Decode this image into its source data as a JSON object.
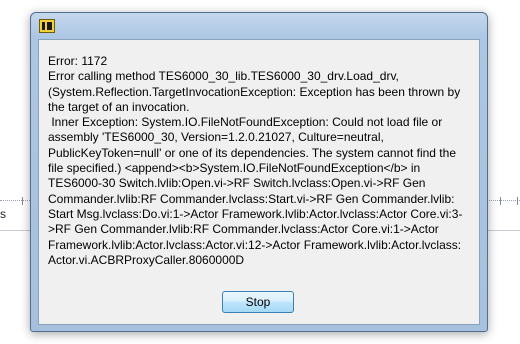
{
  "background": {
    "partial_label": "s"
  },
  "dialog": {
    "title": "",
    "icon": "labview-icon",
    "message": "Error: 1172\nError calling method TES6000_30_lib.TES6000_30_drv.Load_drv,\n(System.Reflection.TargetInvocationException: Exception has been thrown by\nthe target of an invocation.\n Inner Exception: System.IO.FileNotFoundException: Could not load file or\nassembly 'TES6000_30, Version=1.2.0.21027, Culture=neutral,\nPublicKeyToken=null' or one of its dependencies. The system cannot find the\nfile specified.) <append><b>System.IO.FileNotFoundException</b> in\nTES6000-30 Switch.lvlib:Open.vi->RF Switch.lvclass:Open.vi->RF Gen\nCommander.lvlib:RF Commander.lvclass:Start.vi->RF Gen Commander.lvlib:\nStart Msg.lvclass:Do.vi:1->Actor Framework.lvlib:Actor.lvclass:Actor Core.vi:3-\n>RF Gen Commander.lvlib:RF Commander.lvclass:Actor Core.vi:1->Actor\nFramework.lvlib:Actor.lvclass:Actor.vi:12->Actor Framework.lvlib:Actor.lvclass:\nActor.vi.ACBRProxyCaller.8060000D",
    "stop_label": "Stop"
  }
}
